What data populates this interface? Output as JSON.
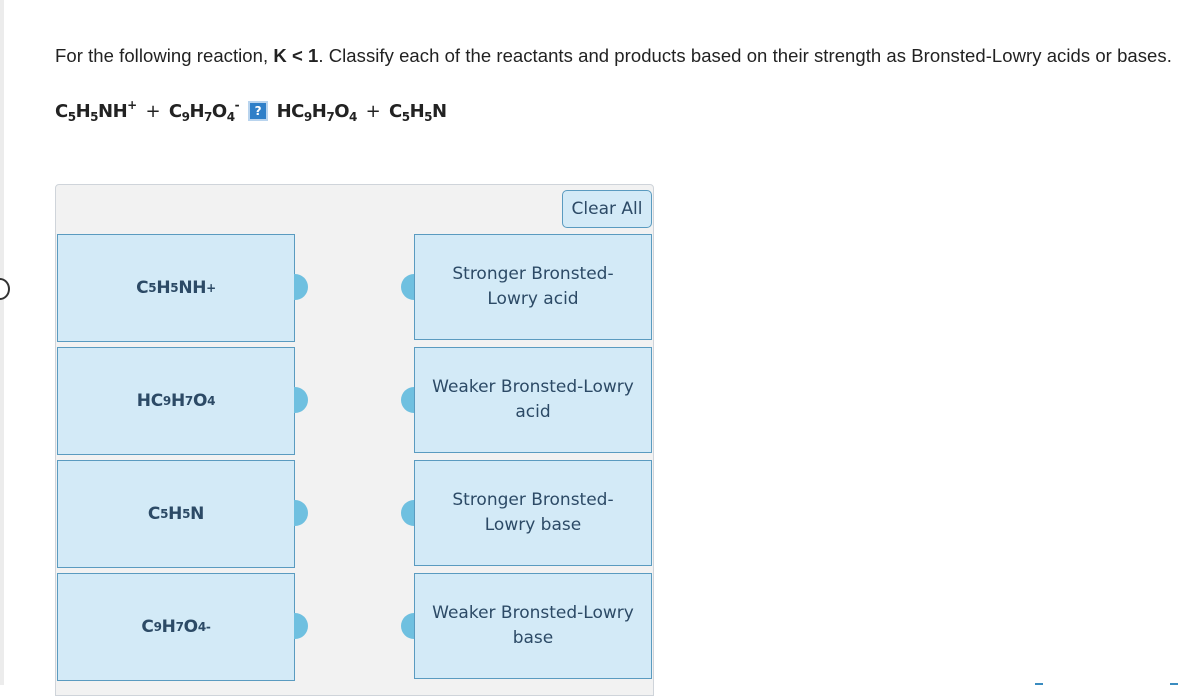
{
  "question": {
    "prefix": "For the following reaction, ",
    "condition": "K < 1",
    "suffix": ". Classify each of the reactants and products based on their strength as Bronsted-Lowry acids or bases."
  },
  "equation": {
    "reactant1": {
      "parts": [
        "C",
        "5",
        "H",
        "5",
        "NH",
        "+"
      ]
    },
    "plus": "+",
    "reactant2": {
      "parts": [
        "C",
        "9",
        "H",
        "7",
        "O",
        "4",
        "-"
      ]
    },
    "arrow_icon": "?",
    "product1": {
      "parts": [
        "HC",
        "9",
        "H",
        "7",
        "O",
        "4"
      ]
    },
    "product2": {
      "parts": [
        "C",
        "5",
        "H",
        "5",
        "N"
      ]
    }
  },
  "clear_all_label": "Clear All",
  "terms": [
    {
      "id": "c5h5nh",
      "parts": [
        "C",
        "5",
        "H",
        "5",
        "NH",
        "+"
      ]
    },
    {
      "id": "hc9h7o4",
      "parts": [
        "HC",
        "9",
        "H",
        "7",
        "O",
        "4"
      ]
    },
    {
      "id": "c5h5n",
      "parts": [
        "C",
        "5",
        "H",
        "5",
        "N"
      ]
    },
    {
      "id": "c9h7o4",
      "parts": [
        "C",
        "9",
        "H",
        "7",
        "O",
        "4",
        "-"
      ]
    }
  ],
  "categories": [
    {
      "line1": "Stronger Bronsted-",
      "line2": "Lowry acid"
    },
    {
      "line1": "Weaker Bronsted-Lowry",
      "line2": "acid"
    },
    {
      "line1": "Stronger Bronsted-",
      "line2": "Lowry base"
    },
    {
      "line1": "Weaker Bronsted-Lowry",
      "line2": "base"
    }
  ],
  "colors": {
    "box_fill": "#d3eaf7",
    "box_border": "#5a9bc0",
    "knob": "#6fc0e0",
    "text": "#2c4a66",
    "panel": "#f2f2f2"
  }
}
